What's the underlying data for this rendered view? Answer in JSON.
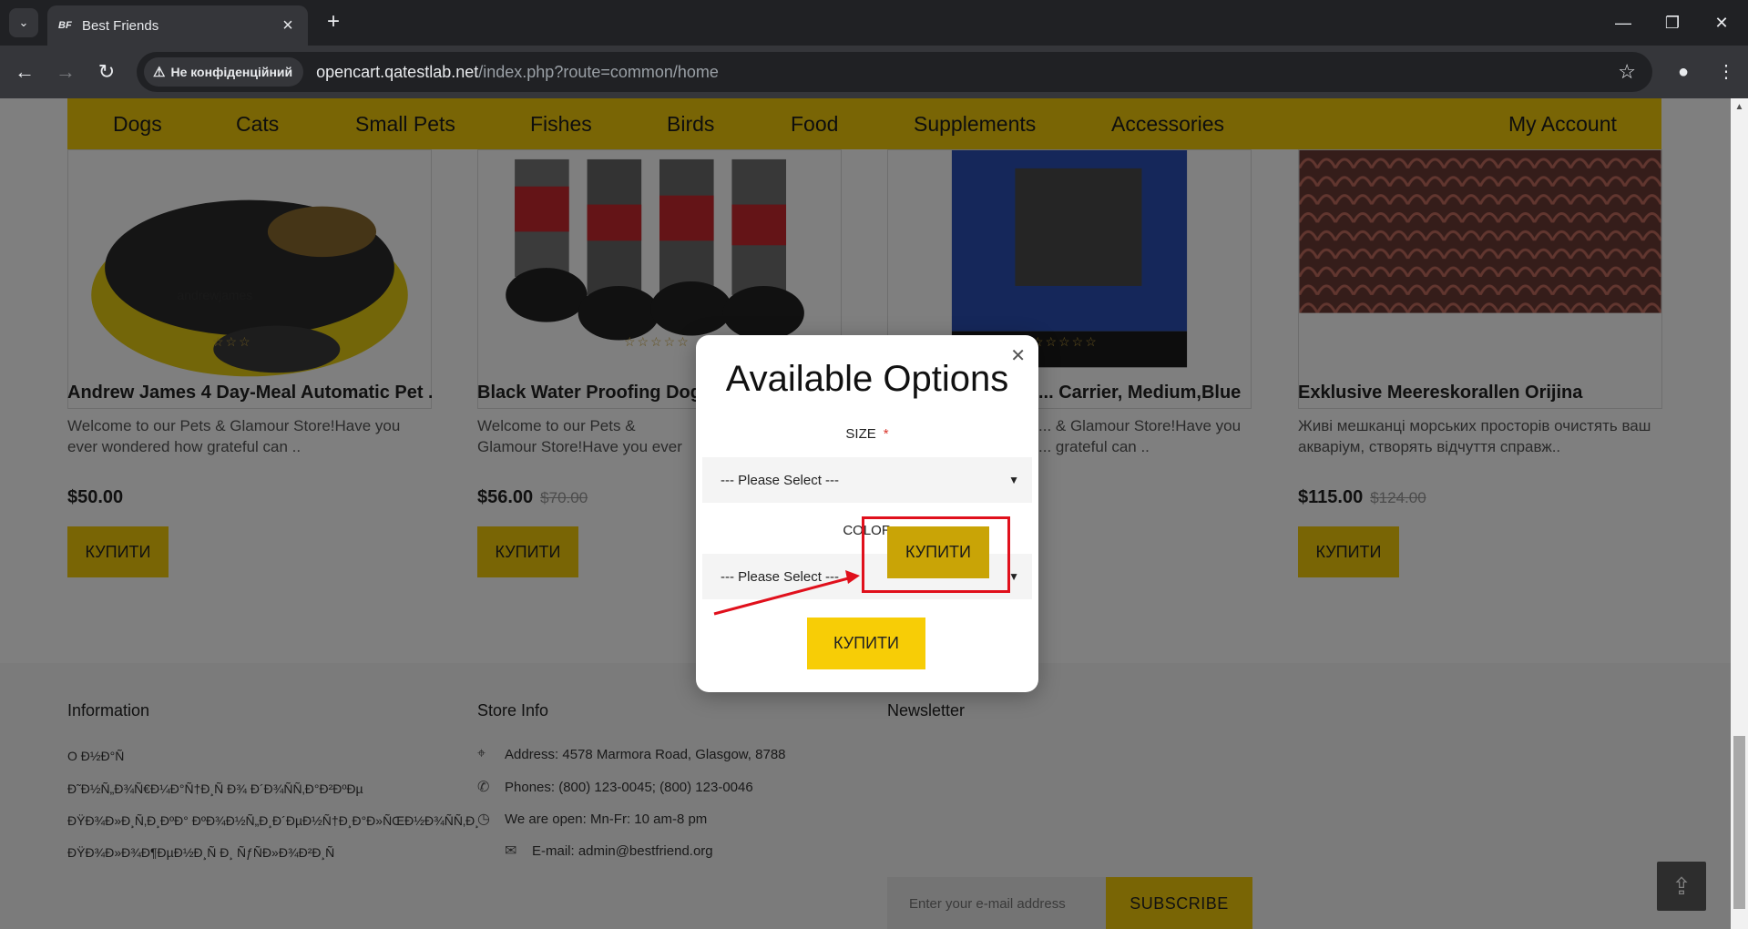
{
  "browser": {
    "tab_title": "Best Friends",
    "tab_favicon": "BF",
    "security_label": "Не конфіденційний",
    "url_host": "opencart.qatestlab.net",
    "url_path": "/index.php?route=common/home"
  },
  "menu": {
    "items": [
      "Dogs",
      "Cats",
      "Small Pets",
      "Fishes",
      "Birds",
      "Food",
      "Supplements",
      "Accessories"
    ],
    "account": "My Account"
  },
  "products": [
    {
      "name": "Andrew James 4 Day-Meal Automatic Pet ...",
      "desc": "Welcome to our Pets & Glamour Store!Have you ever wondered how grateful can ..",
      "price": "$50.00",
      "old_price": "",
      "buy": "КУПИТИ",
      "rating_text": "☆☆☆",
      "img_brand": "andrewjames"
    },
    {
      "name": "Black Water Proofing Dog B...",
      "desc": "Welcome to our Pets & Glamour Store!Have you ever wondered how grateful can ..",
      "price": "$56.00",
      "old_price": "$70.00",
      "buy": "КУПИТИ",
      "rating_text": "☆☆☆☆☆"
    },
    {
      "name": "... Carrier, Medium,Blue",
      "desc": "... & Glamour Store!Have you ... grateful can ..",
      "price": "",
      "old_price": "",
      "buy": "",
      "rating_text": "☆☆☆☆☆"
    },
    {
      "name": "Exklusive Meereskorallen Orijina",
      "desc": "Живі мешканці морських просторів очистять ваш акваріум, створять відчуття справж..",
      "price": "$115.00",
      "old_price": "$124.00",
      "buy": "КУПИТИ"
    }
  ],
  "footer": {
    "information_title": "Information",
    "info_links": [
      "О Ð½Ð°Ñ",
      "Ð˜Ð½Ñ„Ð¾Ñ€Ð¼Ð°Ñ†Ð¸Ñ Ð¾ Ð´Ð¾ÑÑ‚Ð°Ð²ÐºÐµ",
      "ÐŸÐ¾Ð»Ð¸Ñ‚Ð¸ÐºÐ° ÐºÐ¾Ð½Ñ„Ð¸Ð´ÐµÐ½Ñ†Ð¸Ð°Ð»ÑŒÐ½Ð¾ÑÑ‚Ð¸",
      "ÐŸÐ¾Ð»Ð¾Ð¶ÐµÐ½Ð¸Ñ Ð¸ ÑƒÑÐ»Ð¾Ð²Ð¸Ñ"
    ],
    "store_title": "Store Info",
    "address": "Address: 4578 Marmora Road, Glasgow, 8788",
    "phones": "Phones: (800) 123-0045; (800) 123-0046",
    "hours": "We are open: Mn-Fr: 10 am-8 pm",
    "email": "E-mail: admin@bestfriend.org",
    "newsletter_title": "Newsletter",
    "email_placeholder": "Enter your e-mail address",
    "subscribe": "SUBSCRIBE"
  },
  "modal": {
    "title": "Available Options",
    "size_label": "SIZE",
    "required_mark": "*",
    "size_value": "--- Please Select ---",
    "color_label": "COLOR",
    "color_value": "--- Please Select ---",
    "buy": "КУПИТИ"
  },
  "annotation": {
    "buy": "КУПИТИ",
    "color": "#e0101c"
  }
}
